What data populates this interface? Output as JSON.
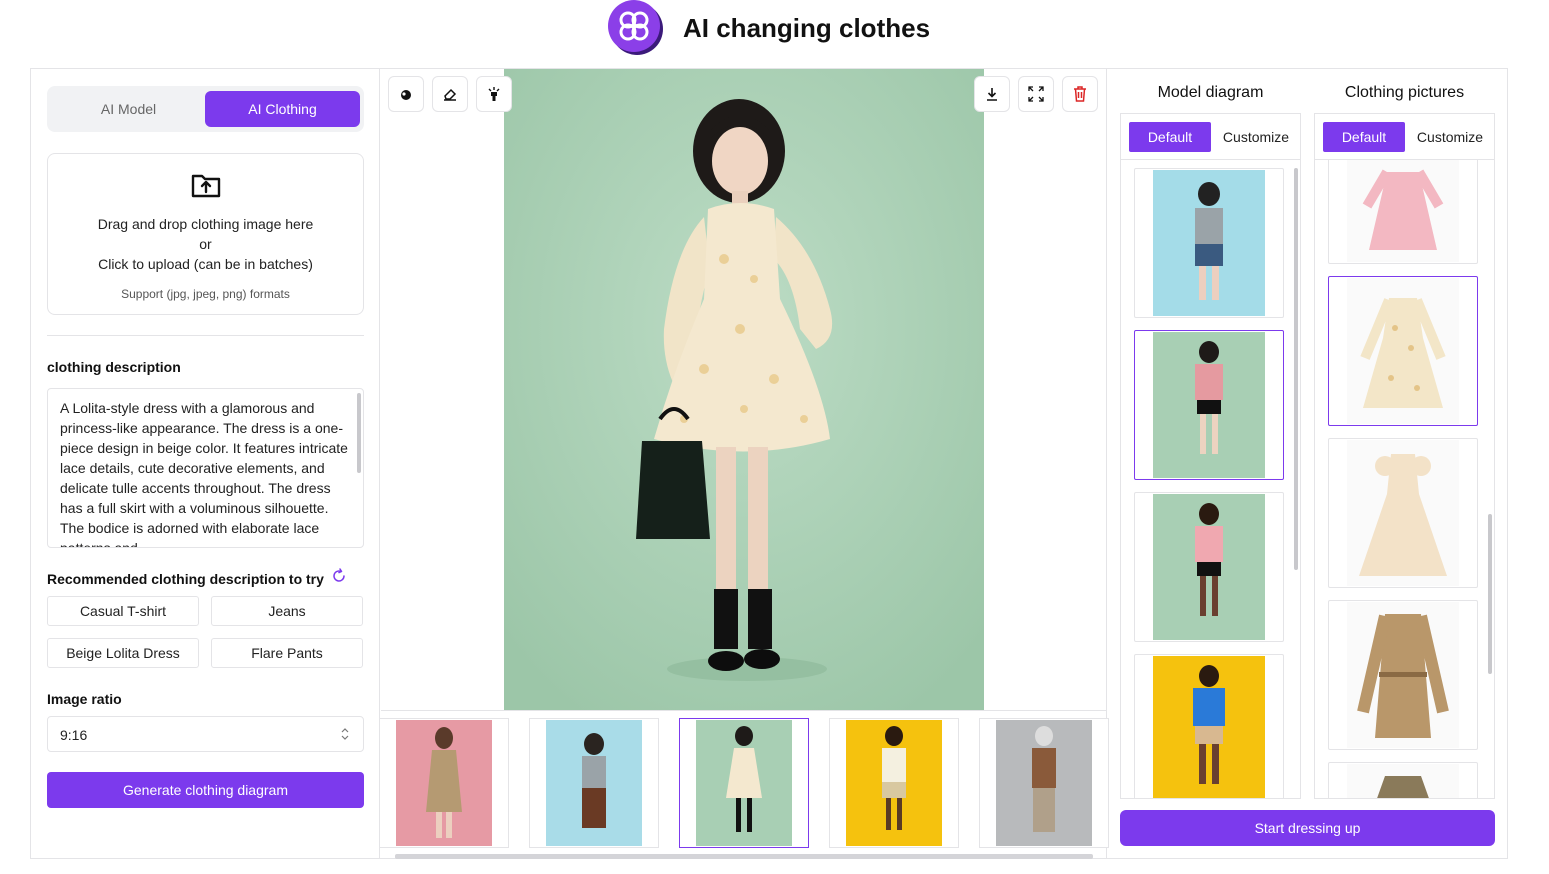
{
  "app": {
    "title": "AI changing clothes"
  },
  "colors": {
    "accent": "#7c3aed",
    "border": "#e4e4e7",
    "delete": "#dc2626"
  },
  "left": {
    "mode_tabs": [
      "AI Model",
      "AI Clothing"
    ],
    "active_mode": "AI Clothing",
    "upload": {
      "line1": "Drag and drop clothing image here",
      "line2": "or",
      "line3": "Click to upload (can be in batches)",
      "formats": "Support (jpg, jpeg, png) formats"
    },
    "description_label": "clothing description",
    "description_text": "A Lolita-style dress with a glamorous and princess-like appearance. The dress is a one-piece design in beige color. It features intricate lace details, cute decorative elements, and delicate tulle accents throughout. The dress has a full skirt with a voluminous silhouette. The bodice is adorned with elaborate lace patterns and",
    "recommended_label": "Recommended clothing description to try",
    "chips": [
      "Casual T-shirt",
      "Jeans",
      "Beige Lolita Dress",
      "Flare Pants"
    ],
    "ratio_label": "Image ratio",
    "ratio_value": "9:16",
    "generate_label": "Generate clothing diagram"
  },
  "center": {
    "toolbar_left": [
      "brush-icon",
      "eraser-icon",
      "magic-wand-icon"
    ],
    "toolbar_right": [
      "download-icon",
      "fullscreen-icon",
      "trash-icon"
    ],
    "selected_thumbnail": 3,
    "thumbnails": [
      "trench coat on pink",
      "boy on light blue",
      "lace dress on green",
      "graphic tee on yellow",
      "striped shirt on grey"
    ]
  },
  "right": {
    "model_title": "Model diagram",
    "clothing_title": "Clothing pictures",
    "tab_default": "Default",
    "tab_customize": "Customize",
    "model_selected": 2,
    "clothing_selected": 2,
    "start_label": "Start dressing up"
  }
}
